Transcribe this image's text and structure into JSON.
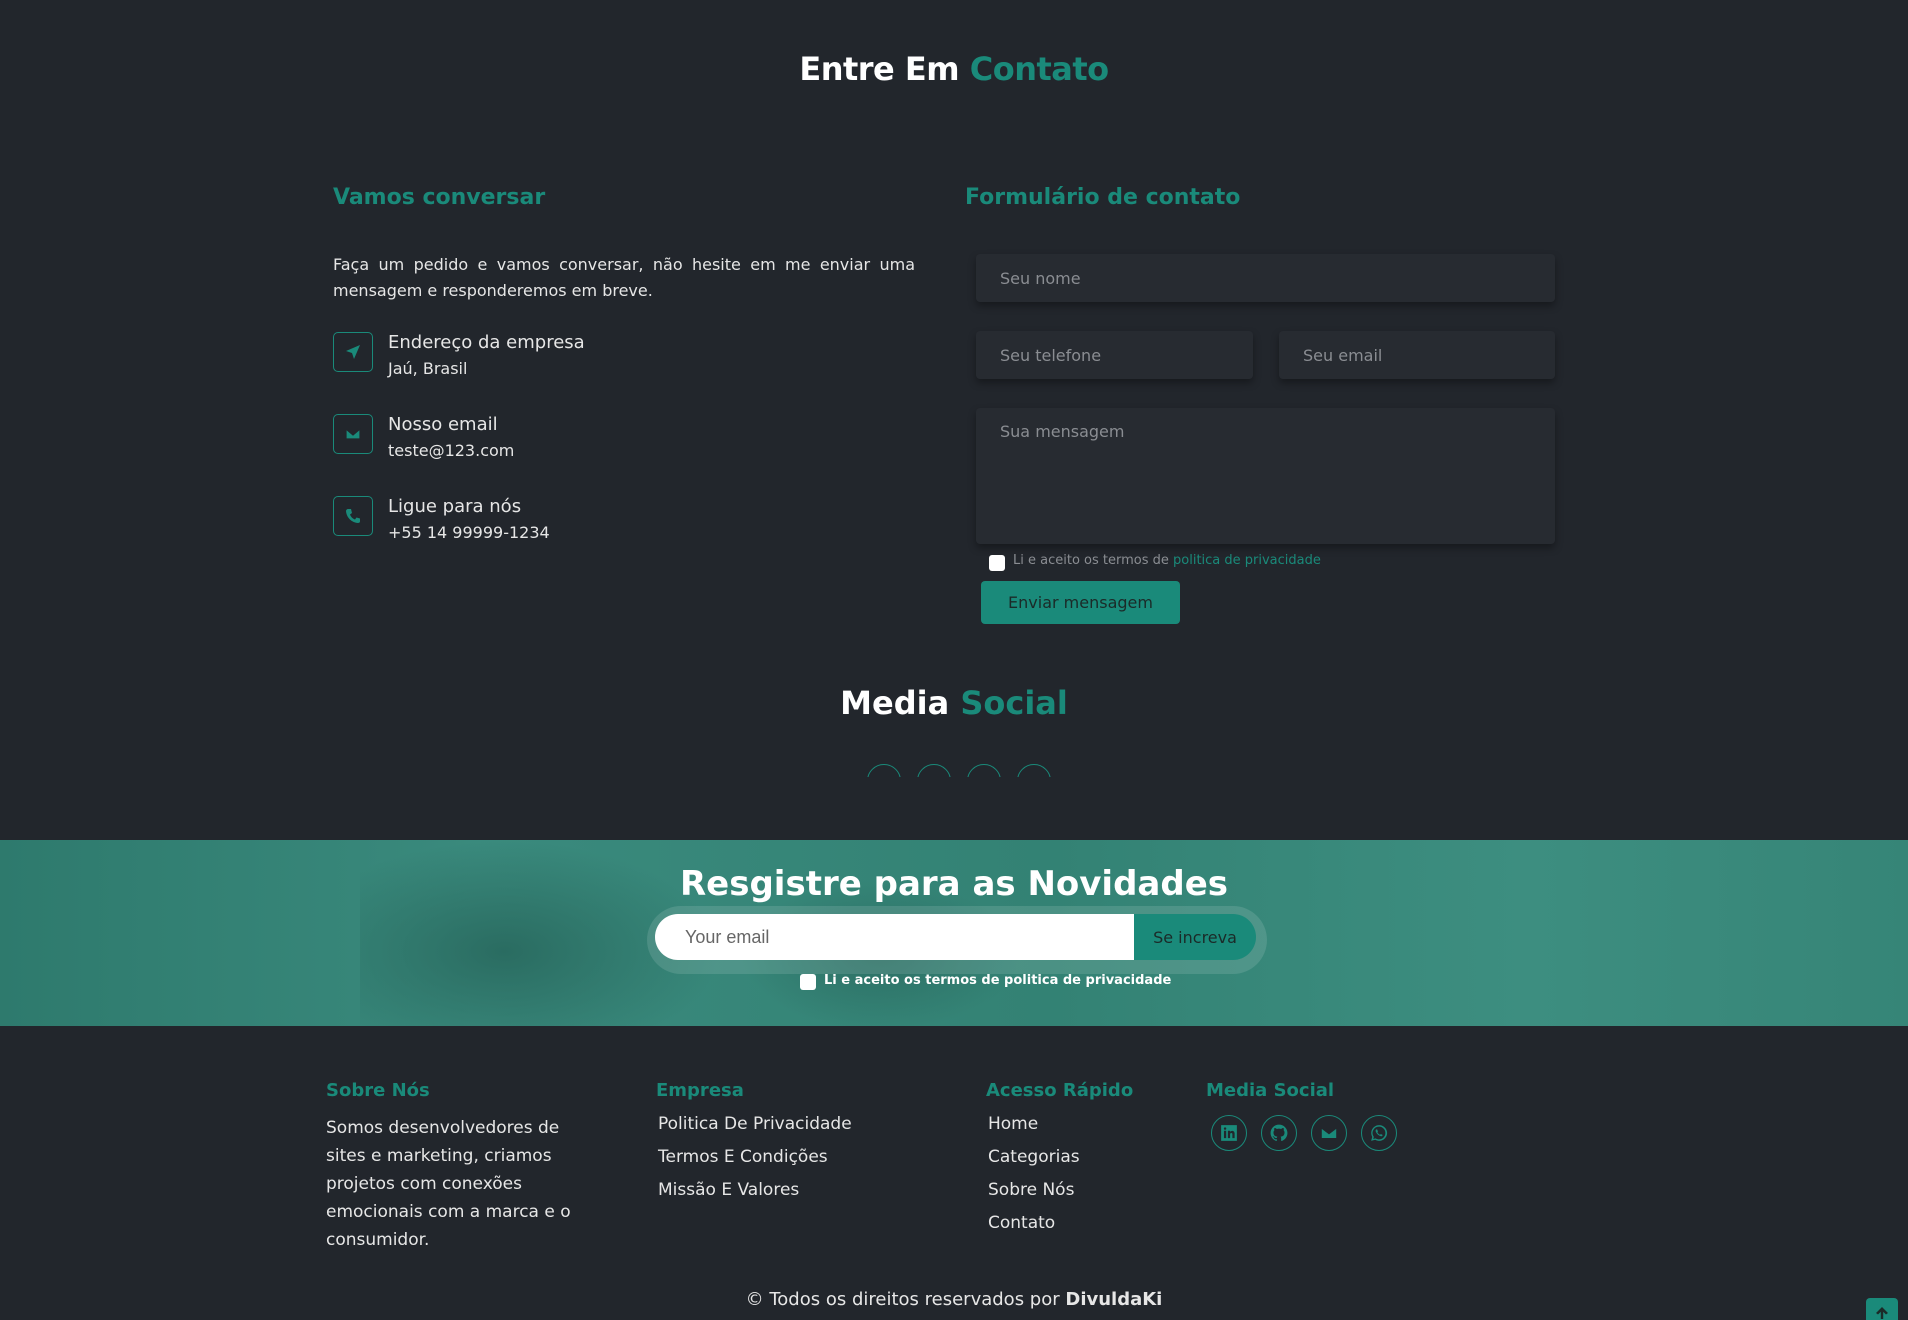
{
  "contact": {
    "title_part1": "Entre Em",
    "title_part2": "Contato",
    "left_title": "Vamos conversar",
    "right_title": "Formulário de contato",
    "lead": "Faça um pedido e vamos conversar, não hesite em me enviar uma mensagem e responderemos em breve.",
    "items": [
      {
        "label": "Endereço da empresa",
        "value": "Jaú, Brasil",
        "icon": "location-arrow-icon"
      },
      {
        "label": "Nosso email",
        "value": "teste@123.com",
        "icon": "envelope-icon"
      },
      {
        "label": "Ligue para nós",
        "value": "+55 14 99999-1234",
        "icon": "phone-icon"
      }
    ],
    "form": {
      "name_placeholder": "Seu nome",
      "phone_placeholder": "Seu telefone",
      "email_placeholder": "Seu email",
      "message_placeholder": "Sua mensagem",
      "terms_text": "Li e aceito os termos de",
      "terms_link": "politica de privacidade",
      "submit_label": "Enviar mensagem"
    }
  },
  "social": {
    "title_part1": "Media",
    "title_part2": "Social"
  },
  "newsletter": {
    "title": "Resgistre para as Novidades",
    "email_placeholder": "Your email",
    "button_label": "Se increva",
    "terms_text": "Li e aceito os termos de politica de privacidade"
  },
  "footer": {
    "about_title": "Sobre Nós",
    "about_text": "Somos desenvolvedores de sites e marketing, criamos projetos com conexões emocionais com a marca e o consumidor.",
    "company_title": "Empresa",
    "company_links": [
      "Politica De Privacidade",
      "Termos E Condições",
      "Missão E Valores"
    ],
    "quick_title": "Acesso Rápido",
    "quick_links": [
      "Home",
      "Categorias",
      "Sobre Nós",
      "Contato"
    ],
    "social_title": "Media Social",
    "social_icons": [
      "linkedin-icon",
      "github-icon",
      "envelope-icon",
      "whatsapp-icon"
    ],
    "copyright_prefix": "© Todos os direitos reservados por",
    "copyright_brand": "DivuldaKi"
  },
  "colors": {
    "background": "#22262c",
    "accent": "#1a8a7a",
    "text": "#e6e6e6",
    "field_bg": "#272b31"
  }
}
